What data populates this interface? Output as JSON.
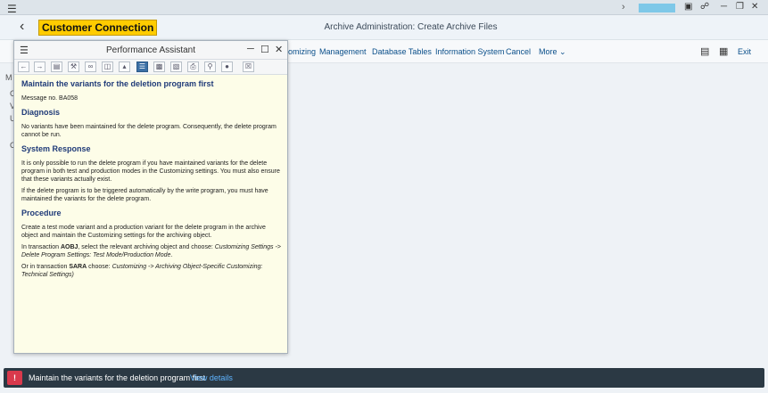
{
  "system_bar": {
    "menu_icon": "hamburger-icon",
    "chevron": "›",
    "icons": [
      "run-icon",
      "lock-icon"
    ],
    "window_controls": [
      "minimize-icon",
      "restore-icon",
      "close-icon"
    ]
  },
  "header": {
    "back_icon": "back-arrow-icon",
    "brand": "Customer Connection",
    "title": "Archive Administration: Create Archive Files"
  },
  "toolbar": {
    "items": [
      "omizing",
      "Management",
      "Database Tables",
      "Information System",
      "Cancel",
      "More"
    ],
    "exit_label": "Exit",
    "icons": [
      "window-icon",
      "export-icon"
    ]
  },
  "background_labels": [
    "M",
    "C",
    "V",
    "U",
    "C"
  ],
  "popup": {
    "title": "Performance Assistant",
    "header_controls": [
      "minimize-icon",
      "maximize-icon",
      "close-icon"
    ],
    "tools": [
      "back",
      "forward",
      "doc",
      "tools",
      "link",
      "copy",
      "tree",
      "longtext",
      "settings",
      "print-preview",
      "print",
      "search",
      "user",
      "exit"
    ],
    "heading": "Maintain the variants for the deletion program first",
    "message_no": "Message no. BA058",
    "diagnosis_heading": "Diagnosis",
    "diagnosis_text": "No variants have been maintained for the delete program. Consequently, the delete program cannot be run.",
    "system_response_heading": "System Response",
    "system_response_p1": "It is only possible to run the delete program if you have maintained variants for the delete program in both test and production modes in the Customizing settings. You must also ensure that these variants actually exist.",
    "system_response_p2": "If the delete program is to be triggered automatically by the write program, you must have maintained the variants for the delete program.",
    "procedure_heading": "Procedure",
    "procedure_p1": "Create a test mode variant and a production variant for the delete program in the archive object and maintain the Customizing settings for the archiving object.",
    "procedure_p2_prefix": "In transaction ",
    "procedure_p2_code": "AOBJ",
    "procedure_p2_mid": ",  select the relevant archiving object and choose: ",
    "procedure_p2_path": "Customizing Settings -> Delete Program Settings: Test Mode/Production Mode",
    "procedure_p2_suffix": ".",
    "procedure_p3_prefix": "Or in transaction ",
    "procedure_p3_code": "SARA",
    "procedure_p3_mid": " choose: ",
    "procedure_p3_path": "Customizing -> Archiving Object-Specific Customizing: Technical Settings)"
  },
  "status_bar": {
    "icon": "error-icon",
    "message": "Maintain the variants for the deletion program first",
    "link": "View details"
  },
  "colors": {
    "brand_bg": "#ffcc00",
    "status_bg": "#2b3944",
    "error": "#d9394c",
    "link": "#5fb4ff",
    "heading": "#1f3a78"
  }
}
